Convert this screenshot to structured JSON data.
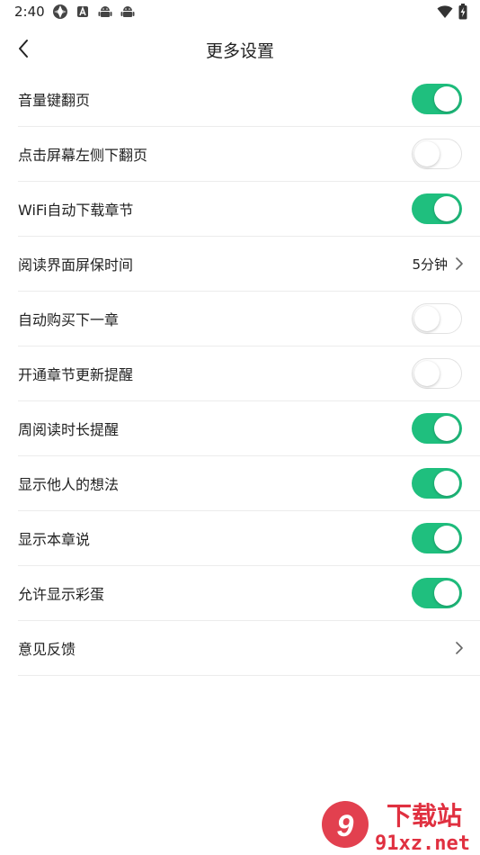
{
  "status_bar": {
    "time": "2:40"
  },
  "header": {
    "title": "更多设置"
  },
  "settings": [
    {
      "label": "音量键翻页",
      "type": "toggle",
      "on": true
    },
    {
      "label": "点击屏幕左侧下翻页",
      "type": "toggle",
      "on": false
    },
    {
      "label": "WiFi自动下载章节",
      "type": "toggle",
      "on": true
    },
    {
      "label": "阅读界面屏保时间",
      "type": "link",
      "value": "5分钟"
    },
    {
      "label": "自动购买下一章",
      "type": "toggle",
      "on": false
    },
    {
      "label": "开通章节更新提醒",
      "type": "toggle",
      "on": false
    },
    {
      "label": "周阅读时长提醒",
      "type": "toggle",
      "on": true
    },
    {
      "label": "显示他人的想法",
      "type": "toggle",
      "on": true
    },
    {
      "label": "显示本章说",
      "type": "toggle",
      "on": true
    },
    {
      "label": "允许显示彩蛋",
      "type": "toggle",
      "on": true
    },
    {
      "label": "意见反馈",
      "type": "link",
      "value": ""
    }
  ],
  "watermark": {
    "brand": "下载站",
    "domain": "91xz.net"
  },
  "colors": {
    "accent": "#1fbf7e",
    "watermark": "#e03040"
  }
}
